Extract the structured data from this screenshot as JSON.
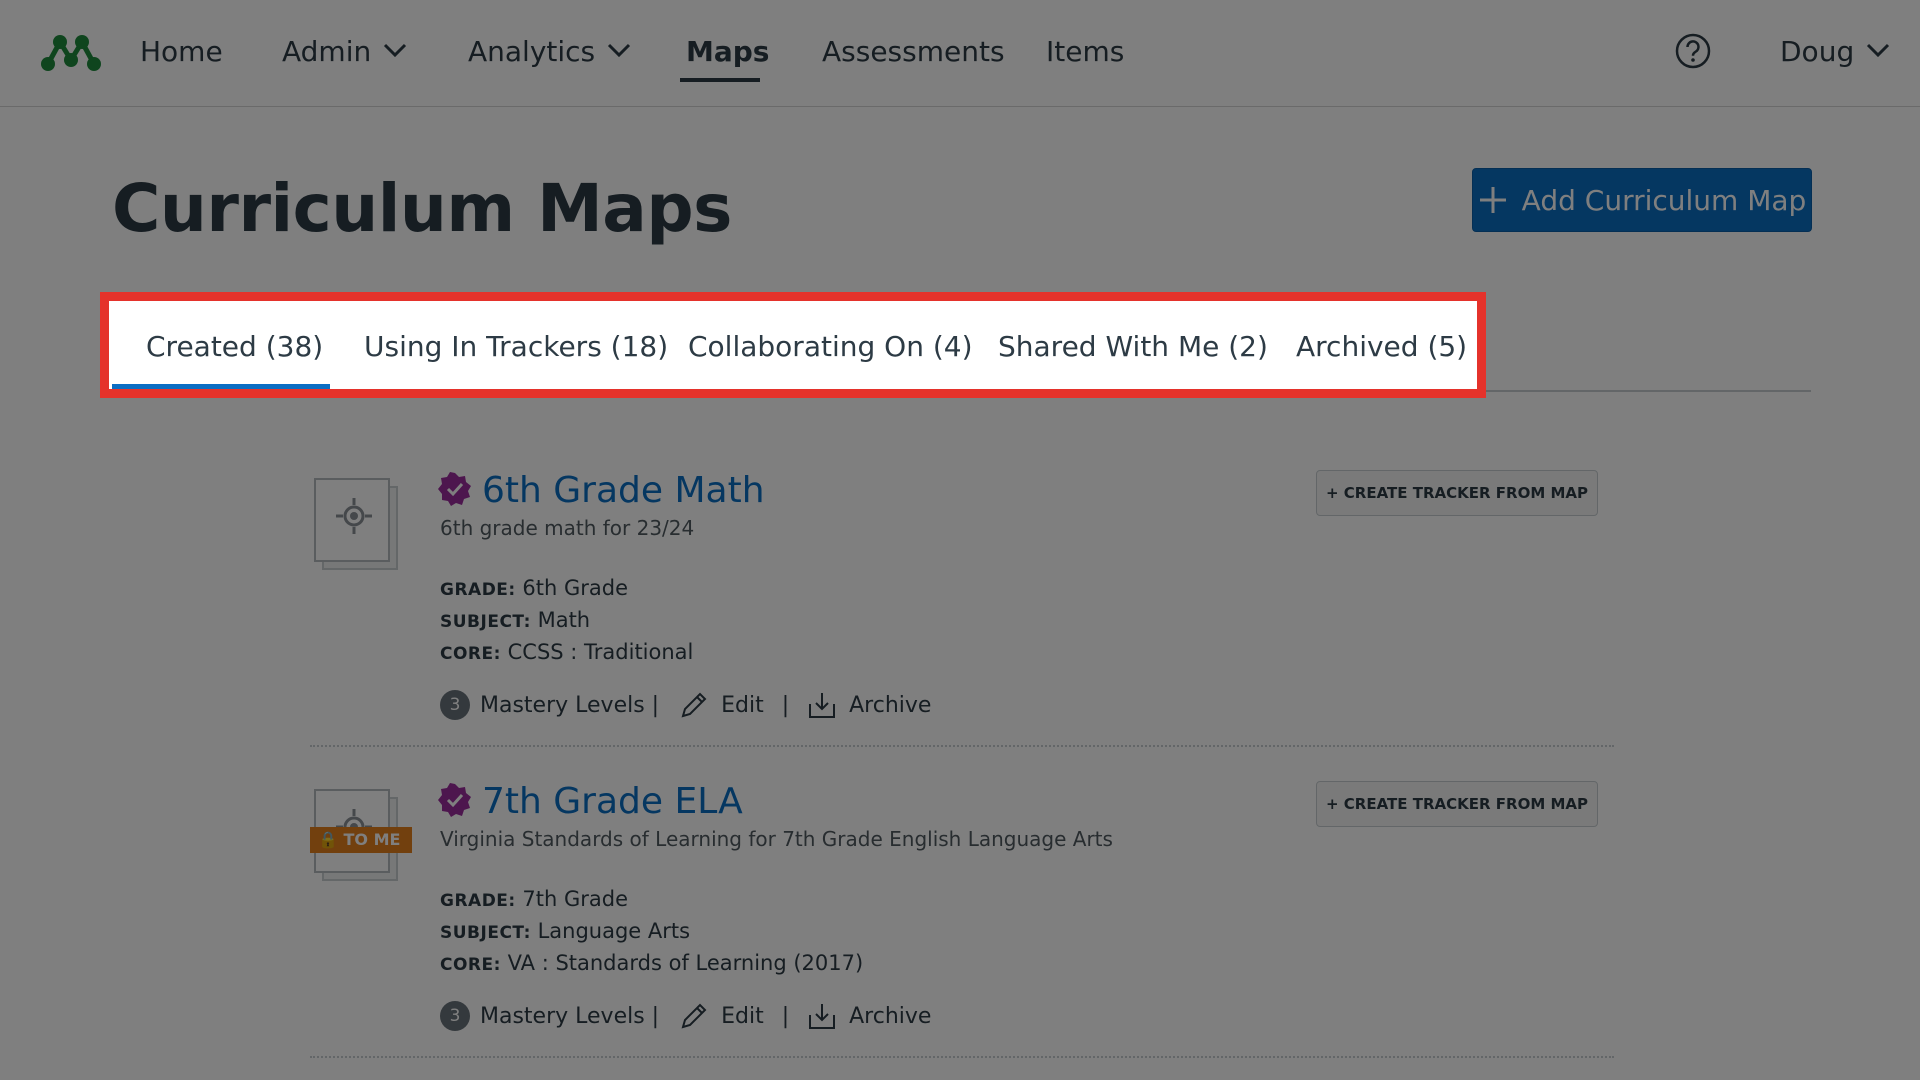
{
  "nav": {
    "items": [
      {
        "label": "Home",
        "active": false,
        "dropdown": false
      },
      {
        "label": "Admin",
        "active": false,
        "dropdown": true
      },
      {
        "label": "Analytics",
        "active": false,
        "dropdown": true
      },
      {
        "label": "Maps",
        "active": true,
        "dropdown": false
      },
      {
        "label": "Assessments",
        "active": false,
        "dropdown": false
      },
      {
        "label": "Items",
        "active": false,
        "dropdown": false
      }
    ],
    "user_label": "Doug",
    "logo_icon": "molecule-logo-icon",
    "help_icon": "question-circle-icon",
    "logo_color": "#1e8a3c"
  },
  "header": {
    "title": "Curriculum Maps",
    "add_button_label": "Add Curriculum Map"
  },
  "tabs": [
    {
      "label": "Created (38)",
      "active": true
    },
    {
      "label": "Using In Trackers (18)",
      "active": false
    },
    {
      "label": "Collaborating On (4)",
      "active": false
    },
    {
      "label": "Shared With Me (2)",
      "active": false
    },
    {
      "label": "Archived (5)",
      "active": false
    }
  ],
  "labels": {
    "grade": "GRADE:",
    "subject": "SUBJECT:",
    "core": "CORE:",
    "mastery_levels": "Mastery Levels |",
    "edit": "Edit",
    "archive": "Archive",
    "create_tracker": "+ CREATE TRACKER FROM MAP",
    "pipe": "|"
  },
  "maps": [
    {
      "title": "6th Grade Math",
      "description": "6th grade math for 23/24",
      "grade": "6th Grade",
      "subject": "Math",
      "core": "CCSS : Traditional",
      "mastery_levels": "3",
      "tag": null
    },
    {
      "title": "7th Grade ELA",
      "description": "Virginia Standards of Learning for 7th Grade English Language Arts",
      "grade": "7th Grade",
      "subject": "Language Arts",
      "core": "VA : Standards of Learning (2017)",
      "mastery_levels": "3",
      "tag": "TO ME"
    }
  ],
  "colors": {
    "accent": "#0b6ec3",
    "verified": "#9b2c9d",
    "highlight": "#e5322b",
    "tag": "#e5801c"
  }
}
